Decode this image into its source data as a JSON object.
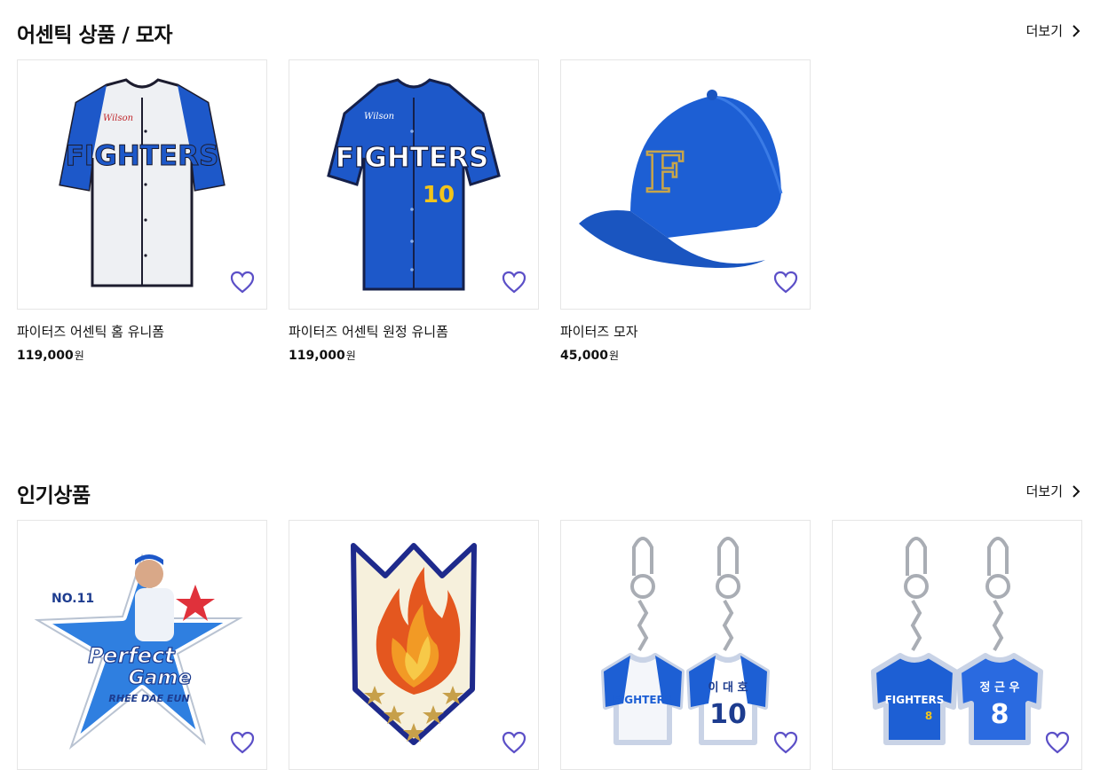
{
  "sections": [
    {
      "title": "어센틱 상품 / 모자",
      "more_label": "더보기",
      "products": [
        {
          "name": "파이터즈 어센틱 홈 유니폼",
          "price": "119,000",
          "currency": "원",
          "jersey_text": "FIGHTERS",
          "brand": "Wilson"
        },
        {
          "name": "파이터즈 어센틱 원정 유니폼",
          "price": "119,000",
          "currency": "원",
          "jersey_text": "FIGHTERS",
          "number": "10",
          "brand": "Wilson"
        },
        {
          "name": "파이터즈 모자",
          "price": "45,000",
          "currency": "원",
          "cap_letter": "F"
        }
      ]
    },
    {
      "title": "인기상품",
      "more_label": "더보기",
      "products": [
        {
          "patch_text_1": "Perfect",
          "patch_text_2": "Game",
          "patch_caption": "RHEE DAE EUN",
          "patch_no": "NO.11"
        },
        {
          "art": "flame-patch"
        },
        {
          "key_jersey_text": "FIGHTERS",
          "key_name": "이 대 호",
          "key_number": "10"
        },
        {
          "key_jersey_text": "FIGHTERS",
          "key_number_small": "8",
          "key_name": "정 근 우",
          "key_number": "8"
        }
      ]
    }
  ],
  "colors": {
    "accent_heart": "#5b4fc7",
    "brand_blue": "#1f5fd1",
    "border": "#e6e6e6"
  }
}
